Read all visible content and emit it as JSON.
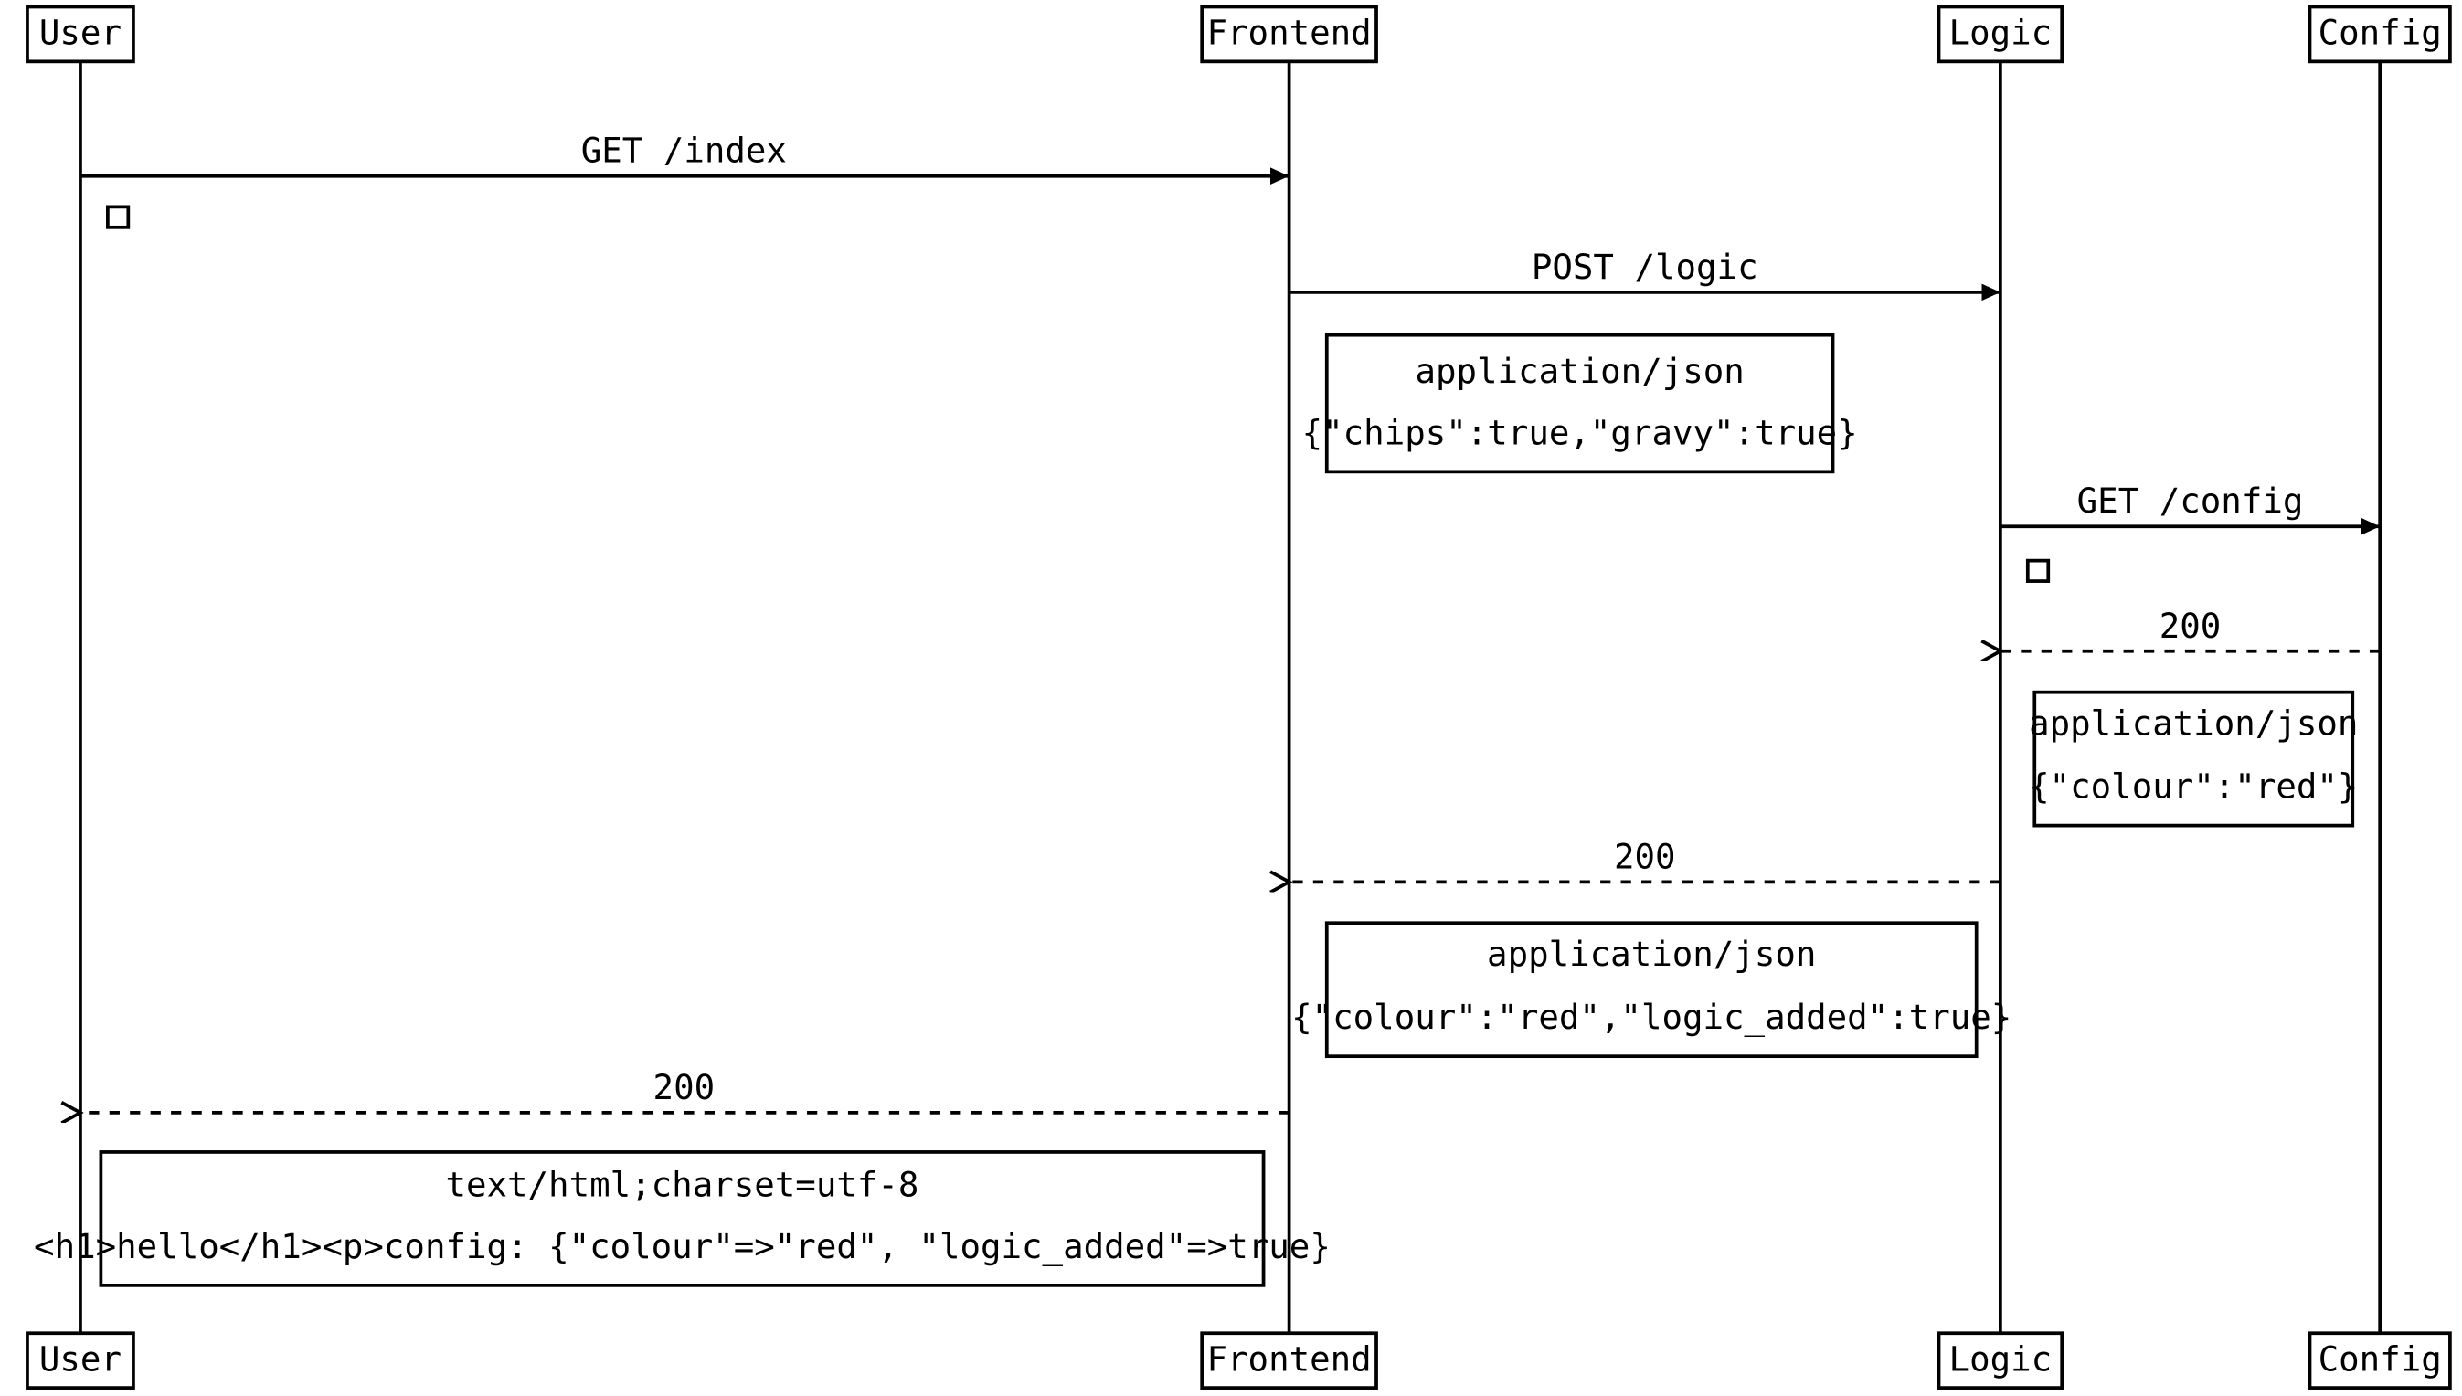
{
  "participants": {
    "user": "User",
    "frontend": "Frontend",
    "logic": "Logic",
    "config": "Config"
  },
  "msg_user_frontend": "GET /index",
  "msg_frontend_logic": "POST /logic",
  "note_frontend_logic_line1": "application/json",
  "note_frontend_logic_line2": "{\"chips\":true,\"gravy\":true}",
  "msg_logic_config": "GET /config",
  "msg_config_logic": "200",
  "note_config_logic_line1": "application/json",
  "note_config_logic_line2": "{\"colour\":\"red\"}",
  "msg_logic_frontend": "200",
  "note_logic_frontend_line1": "application/json",
  "note_logic_frontend_line2": "{\"colour\":\"red\",\"logic_added\":true}",
  "msg_frontend_user": "200",
  "note_frontend_user_line1": "text/html;charset=utf-8",
  "note_frontend_user_line2": "<h1>hello</h1><p>config: {\"colour\"=>\"red\", \"logic_added\"=>true}"
}
